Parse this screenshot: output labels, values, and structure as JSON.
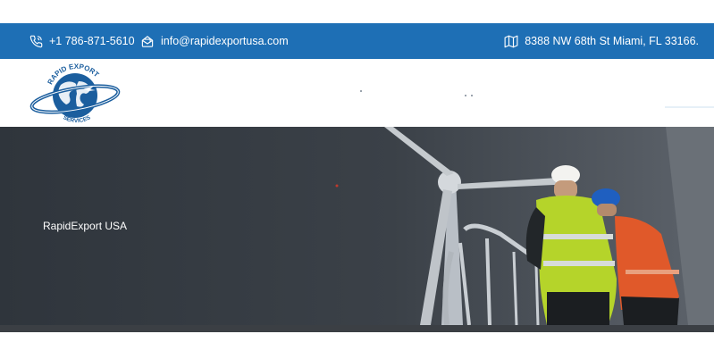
{
  "topbar": {
    "phone": "+1 786-871-5610",
    "email": "info@rapidexportusa.com",
    "address": "8388 NW 68th St Miami, FL 33166."
  },
  "logo": {
    "line1": "RAPID EXPORT",
    "line2": "SERVICES"
  },
  "hero": {
    "title": "RapidExport USA"
  },
  "colors": {
    "topbar": "#1e6fb5",
    "logo_blue": "#1b5e9e",
    "vest_green": "#b5d42a",
    "vest_orange": "#e0592a",
    "hero_dark": "#2f353c"
  }
}
